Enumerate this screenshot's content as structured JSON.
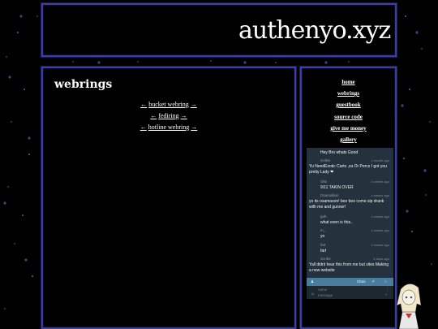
{
  "site": {
    "logo_text": "authenyo.xyz"
  },
  "main": {
    "title": "webrings",
    "rings": [
      {
        "prev": "←",
        "name": "bucket webring",
        "next": "→"
      },
      {
        "prev": "←",
        "name": "fediring",
        "next": "→"
      },
      {
        "prev": "←",
        "name": "hotline webring",
        "next": "→"
      }
    ]
  },
  "nav": {
    "items": [
      {
        "label": "home"
      },
      {
        "label": "webrings"
      },
      {
        "label": "guestbook"
      },
      {
        "label": "source code"
      },
      {
        "label": "give me money"
      },
      {
        "label": "gallery"
      }
    ]
  },
  "chat": {
    "messages": [
      {
        "name": "",
        "time": "",
        "text": "Hey Bro whats Good"
      },
      {
        "name": "scribe",
        "time": "1 month ago",
        "text": "Yu NeedExotic Carts ,za Or Percs I got you pretty Lady ❤"
      },
      {
        "name": "Olm",
        "time": "4 weeks ago",
        "text": "9/11 TAKIN OVER"
      },
      {
        "name": "Osamallion",
        "time": "4 weeks ago",
        "text": "yo its osamason! bee bee come sip drank with me and gunner!"
      },
      {
        "name": "guh",
        "time": "4 weeks ago",
        "text": "what even is this.."
      },
      {
        "name": "m_",
        "time": "4 weeks ago",
        "text": "yo"
      },
      {
        "name": "fart",
        "time": "3 weeks ago",
        "text": "fart"
      },
      {
        "name": "Scribe",
        "time": "5 days ago",
        "text": "Yall didnt hear this from me but sites Making a new website"
      }
    ],
    "bar_brand": "Cbox",
    "name_placeholder": "name",
    "message_placeholder": "message"
  }
}
